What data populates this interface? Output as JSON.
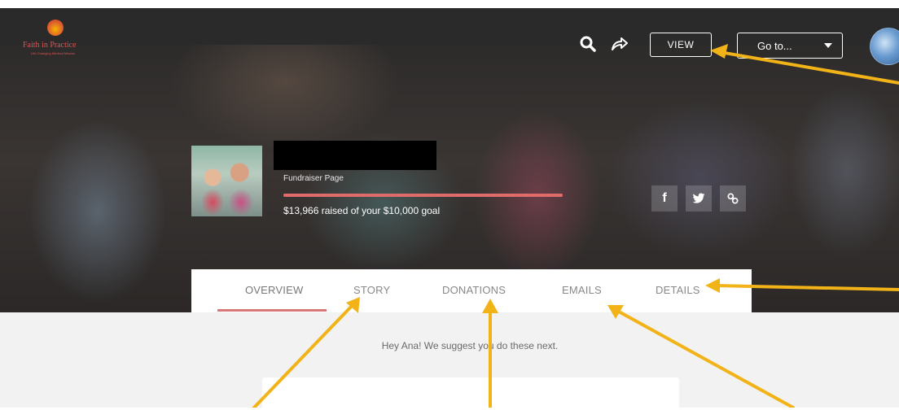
{
  "brand": {
    "name": "Faith in Practice",
    "tagline": "Life Changing Medical Mission",
    "accent": "#d9534f"
  },
  "header": {
    "search_icon": "search-icon",
    "share_icon": "share-arrow-icon",
    "view_label": "VIEW",
    "goto_label": "Go to..."
  },
  "fundraiser": {
    "page_type": "Fundraiser Page",
    "raised_text": "$13,966 raised of your $10,000 goal",
    "progress_percent": 100,
    "progress_color": "#e06b6b"
  },
  "share": {
    "facebook": "f",
    "twitter": "twitter-icon",
    "link": "link-icon"
  },
  "tabs": [
    {
      "label": "OVERVIEW",
      "active": true
    },
    {
      "label": "STORY",
      "active": false
    },
    {
      "label": "DONATIONS",
      "active": false
    },
    {
      "label": "EMAILS",
      "active": false
    },
    {
      "label": "DETAILS",
      "active": false
    }
  ],
  "content": {
    "suggestion": "Hey Ana! We suggest you do these next."
  },
  "annotation_color": "#f2b318"
}
